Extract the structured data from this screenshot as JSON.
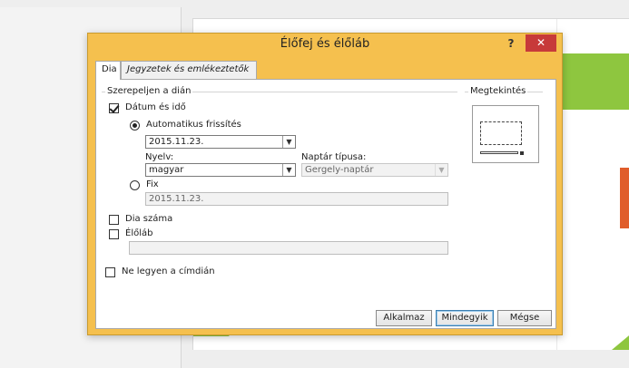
{
  "dialog": {
    "title": "Élőfej és élőláb",
    "help": "?",
    "close": "✕"
  },
  "tabs": [
    {
      "label": "Dia",
      "active": true
    },
    {
      "label": "Jegyzetek és emlékeztetők",
      "active": false
    }
  ],
  "include": {
    "group_label": "Szerepeljen a dián",
    "date_time": {
      "label": "Dátum és idő",
      "checked": true
    },
    "auto_update": {
      "label": "Automatikus frissítés",
      "selected": true,
      "value": "2015.11.23."
    },
    "language": {
      "label": "Nyelv:",
      "value": "magyar"
    },
    "calendar": {
      "label": "Naptár típusa:",
      "value": "Gergely-naptár"
    },
    "fixed": {
      "label": "Fix",
      "selected": false,
      "value": "2015.11.23."
    },
    "slide_number": {
      "label": "Dia száma",
      "checked": false
    },
    "footer": {
      "label": "Élőláb",
      "checked": false,
      "value": ""
    },
    "no_title": {
      "label": "Ne legyen a címdián",
      "checked": false
    }
  },
  "preview": {
    "label": "Megtekintés"
  },
  "buttons": {
    "apply": "Alkalmaz",
    "apply_all": "Mindegyik",
    "cancel": "Mégse"
  },
  "colors": {
    "dialog_frame": "#f5c04e",
    "close_button": "#c73a3a",
    "slide_green": "#8ec63f",
    "slide_orange": "#e05d2b"
  },
  "icons": [
    "help-icon",
    "close-icon",
    "chevron-down-icon"
  ]
}
